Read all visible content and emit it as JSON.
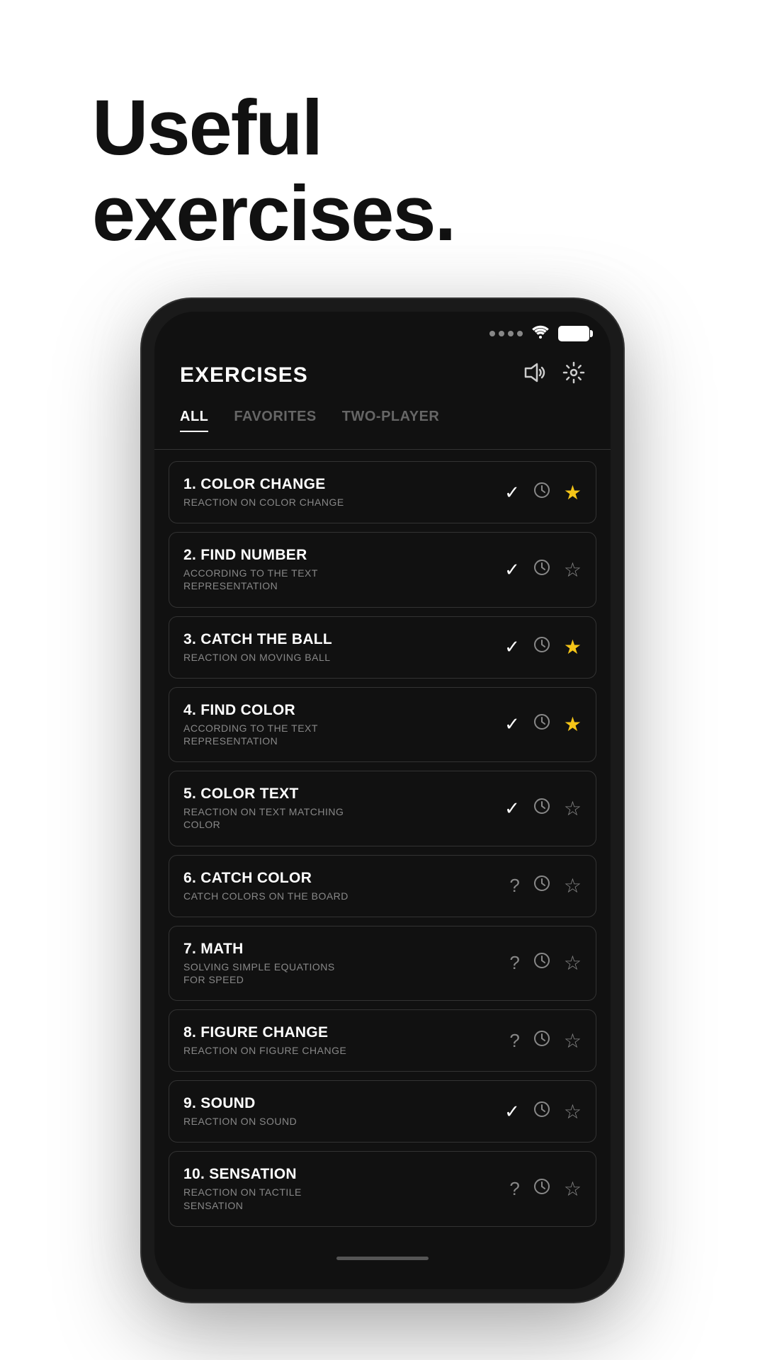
{
  "hero": {
    "title_line1": "Useful",
    "title_line2": "exercises."
  },
  "app": {
    "title": "EXERCISES",
    "sound_icon": "🔔",
    "settings_icon": "⚙"
  },
  "tabs": [
    {
      "label": "ALL",
      "active": true
    },
    {
      "label": "FAVORITES",
      "active": false
    },
    {
      "label": "TWO-PLAYER",
      "active": false
    }
  ],
  "exercises": [
    {
      "number": "1.",
      "name": "COLOR CHANGE",
      "description": "REACTION ON COLOR CHANGE",
      "status": "check",
      "favorited": true
    },
    {
      "number": "2.",
      "name": "FIND NUMBER",
      "description": "ACCORDING TO THE TEXT REPRESENTATION",
      "status": "check",
      "favorited": false
    },
    {
      "number": "3.",
      "name": "CATCH THE BALL",
      "description": "REACTION ON MOVING BALL",
      "status": "check",
      "favorited": true
    },
    {
      "number": "4.",
      "name": "FIND COLOR",
      "description": "ACCORDING TO THE TEXT REPRESENTATION",
      "status": "check",
      "favorited": true
    },
    {
      "number": "5.",
      "name": "COLOR TEXT",
      "description": "REACTION ON TEXT MATCHING COLOR",
      "status": "check",
      "favorited": false
    },
    {
      "number": "6.",
      "name": "CATCH COLOR",
      "description": "CATCH COLORS ON THE BOARD",
      "status": "question",
      "favorited": false
    },
    {
      "number": "7.",
      "name": "MATH",
      "description": "SOLVING SIMPLE EQUATIONS FOR SPEED",
      "status": "question",
      "favorited": false
    },
    {
      "number": "8.",
      "name": "FIGURE CHANGE",
      "description": "REACTION ON FIGURE CHANGE",
      "status": "question",
      "favorited": false
    },
    {
      "number": "9.",
      "name": "SOUND",
      "description": "REACTION ON SOUND",
      "status": "check",
      "favorited": false
    },
    {
      "number": "10.",
      "name": "SENSATION",
      "description": "REACTION ON TACTILE SENSATION",
      "status": "question",
      "favorited": false
    }
  ]
}
